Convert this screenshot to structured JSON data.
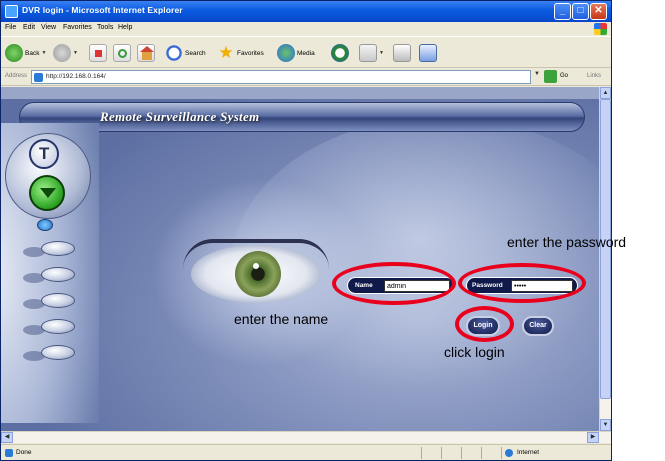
{
  "window": {
    "title": "DVR login - Microsoft Internet Explorer",
    "controls": {
      "minimize": "_",
      "maximize": "□",
      "close": "✕"
    }
  },
  "menu": [
    "File",
    "Edit",
    "View",
    "Favorites",
    "Tools",
    "Help"
  ],
  "toolbar": {
    "back_label": "Back",
    "search_label": "Search",
    "favorites_label": "Favorites",
    "media_label": "Media"
  },
  "address": {
    "label": "Address",
    "url": "http://192.168.0.164/",
    "go_label": "Go",
    "links_label": "Links"
  },
  "page": {
    "banner_title": "Remote Surveillance System",
    "name_label": "Name",
    "name_value": "admin",
    "password_label": "Password",
    "password_value": "•••••",
    "login_label": "Login",
    "clear_label": "Clear"
  },
  "annotations": {
    "password": "enter the password",
    "name": "enter the name",
    "login": "click login",
    "color": "#e8001c"
  },
  "status": {
    "text": "Done",
    "zone": "Internet"
  }
}
